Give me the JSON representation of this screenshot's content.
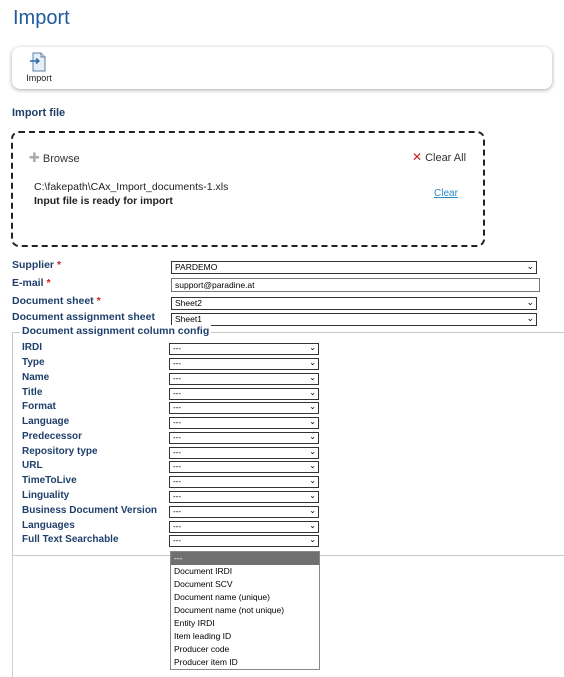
{
  "page": {
    "title": "Import"
  },
  "toolbar": {
    "import_label": "Import"
  },
  "import_file": {
    "section_label": "Import file",
    "browse_label": "Browse",
    "clear_all_label": "Clear All",
    "file_path": "C:\\fakepath\\CAx_Import_documents-1.xls",
    "status": "Input file is ready for import",
    "clear_label": "Clear"
  },
  "form": {
    "supplier": {
      "label": "Supplier",
      "required": "*",
      "value": "PARDEMO"
    },
    "email": {
      "label": "E-mail",
      "required": "*",
      "value": "support@paradine.at"
    },
    "document_sheet": {
      "label": "Document sheet",
      "required": "*",
      "value": "Sheet2"
    },
    "assignment_sheet": {
      "label": "Document assignment sheet",
      "value": "Sheet1"
    }
  },
  "column_config": {
    "legend": "Document assignment column config",
    "rows": [
      {
        "label": "IRDI",
        "value": "---"
      },
      {
        "label": "Type",
        "value": "---"
      },
      {
        "label": "Name",
        "value": "---"
      },
      {
        "label": "Title",
        "value": "---"
      },
      {
        "label": "Format",
        "value": "---"
      },
      {
        "label": "Language",
        "value": "---"
      },
      {
        "label": "Predecessor",
        "value": "---"
      },
      {
        "label": "Repository type",
        "value": "---"
      },
      {
        "label": "URL",
        "value": "---"
      },
      {
        "label": "TimeToLive",
        "value": "---"
      },
      {
        "label": "Linguality",
        "value": "---"
      },
      {
        "label": "Business Document Version",
        "value": "---"
      },
      {
        "label": "Languages",
        "value": "---"
      },
      {
        "label": "Full Text Searchable",
        "value": "---"
      }
    ],
    "open_dropdown_options": [
      "---",
      "Document IRDI",
      "Document SCV",
      "Document name (unique)",
      "Document name (not unique)",
      "Entity IRDI",
      "Item leading ID",
      "Producer code",
      "Producer item ID"
    ]
  },
  "icons": {
    "import": "import-document-icon",
    "browse": "plus-icon",
    "clear_all": "close-x-icon",
    "select": "chevron-down-icon"
  },
  "colors": {
    "title": "#1f5a9c",
    "label": "#1f3f6b",
    "required": "#d02020",
    "link": "#2a8bbf",
    "selected_option": "#707070"
  }
}
